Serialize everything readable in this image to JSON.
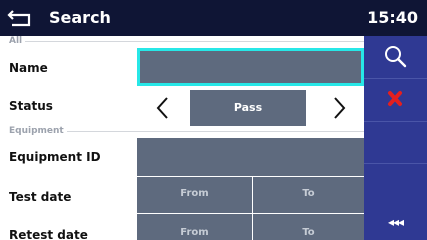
{
  "header": {
    "title": "Search",
    "time": "15:40"
  },
  "sections": {
    "all": "All",
    "equipment": "Equipment"
  },
  "fields": {
    "name_label": "Name",
    "status_label": "Status",
    "status_value": "Pass",
    "equipment_id_label": "Equipment ID",
    "test_date_label": "Test date",
    "retest_date_label": "Retest date",
    "from": "From",
    "to": "To"
  },
  "sidebar": {
    "more": "◂◂◂"
  },
  "colors": {
    "header_bg": "#0f1535",
    "sidebar_bg": "#2f3993",
    "field_bg": "#5e6a7e",
    "focus_border": "#27e7e7",
    "search_icon": "#ffffff",
    "clear_icon": "#e41f1f"
  },
  "icons": [
    "back-arrow-icon",
    "search-icon",
    "clear-filter-icon",
    "arrow-left-icon",
    "arrow-right-icon",
    "more-icon"
  ]
}
